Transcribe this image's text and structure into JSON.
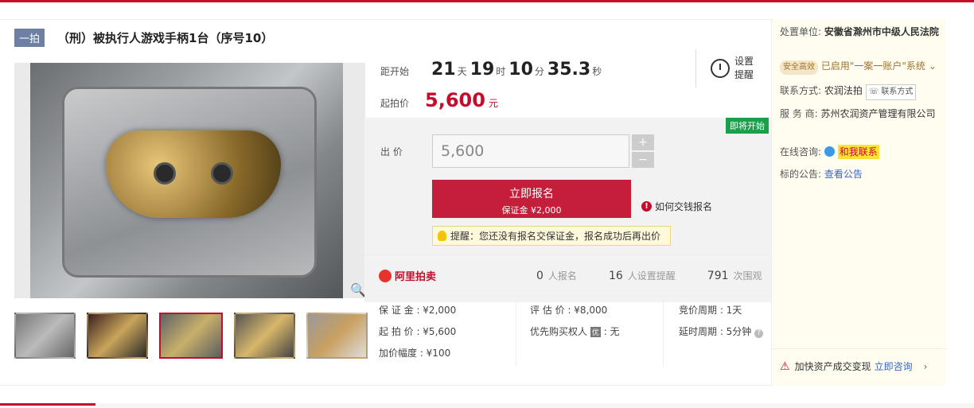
{
  "header": {
    "tag": "一拍",
    "title": "（刑）被执行人游戏手柄1台（序号10）"
  },
  "countdown": {
    "label": "距开始",
    "days": "21",
    "days_unit": "天",
    "hours": "19",
    "hours_unit": "时",
    "minutes": "10",
    "minutes_unit": "分",
    "seconds": "35.3",
    "seconds_unit": "秒"
  },
  "reminder": {
    "label": "设置提醒"
  },
  "start_price": {
    "label": "起拍价",
    "value": "5,600",
    "unit": "元"
  },
  "bid": {
    "status_badge": "即将开始",
    "label": "出  价",
    "value": "5,600",
    "plus": "+",
    "minus": "−",
    "apply_label": "立即报名",
    "deposit_label": "保证金 ¥2,000",
    "how_pay": "如何交钱报名",
    "tip": "提醒：您还没有报名交保证金，报名成功后再出价"
  },
  "stats": {
    "logo": "阿里拍卖",
    "registered": "0",
    "registered_label": "人报名",
    "reminders": "16",
    "reminders_label": "人设置提醒",
    "views": "791",
    "views_label": "次围观"
  },
  "info": {
    "deposit": "保 证 金 : ¥2,000",
    "appraisal": "评 估 价 : ¥8,000",
    "period": "竞价周期 : 1天",
    "start": "起 拍 价 : ¥5,600",
    "priority": "优先购买权人",
    "priority_value": ": 无",
    "priority_badge": "优",
    "delay": "延时周期 : 5分钟",
    "increment": "加价幅度 : ¥100"
  },
  "sidebar": {
    "unit_label": "处置单位:",
    "unit_value": "安徽省滁州市中级人民法院",
    "safe_badge": "安全高效",
    "safe_text": "已启用\"一案一账户\"系统",
    "contact_label": "联系方式:",
    "contact_value": "农润法拍",
    "contact_button": "联系方式",
    "service_label": "服 务 商:",
    "service_value": "苏州农润资产管理有限公司",
    "consult_label": "在线咨询:",
    "consult_value": "和我联系",
    "notice_label": "标的公告:",
    "notice_link": "查看公告",
    "footer_text": "加快资产成交变现",
    "footer_link": "立即咨询"
  }
}
